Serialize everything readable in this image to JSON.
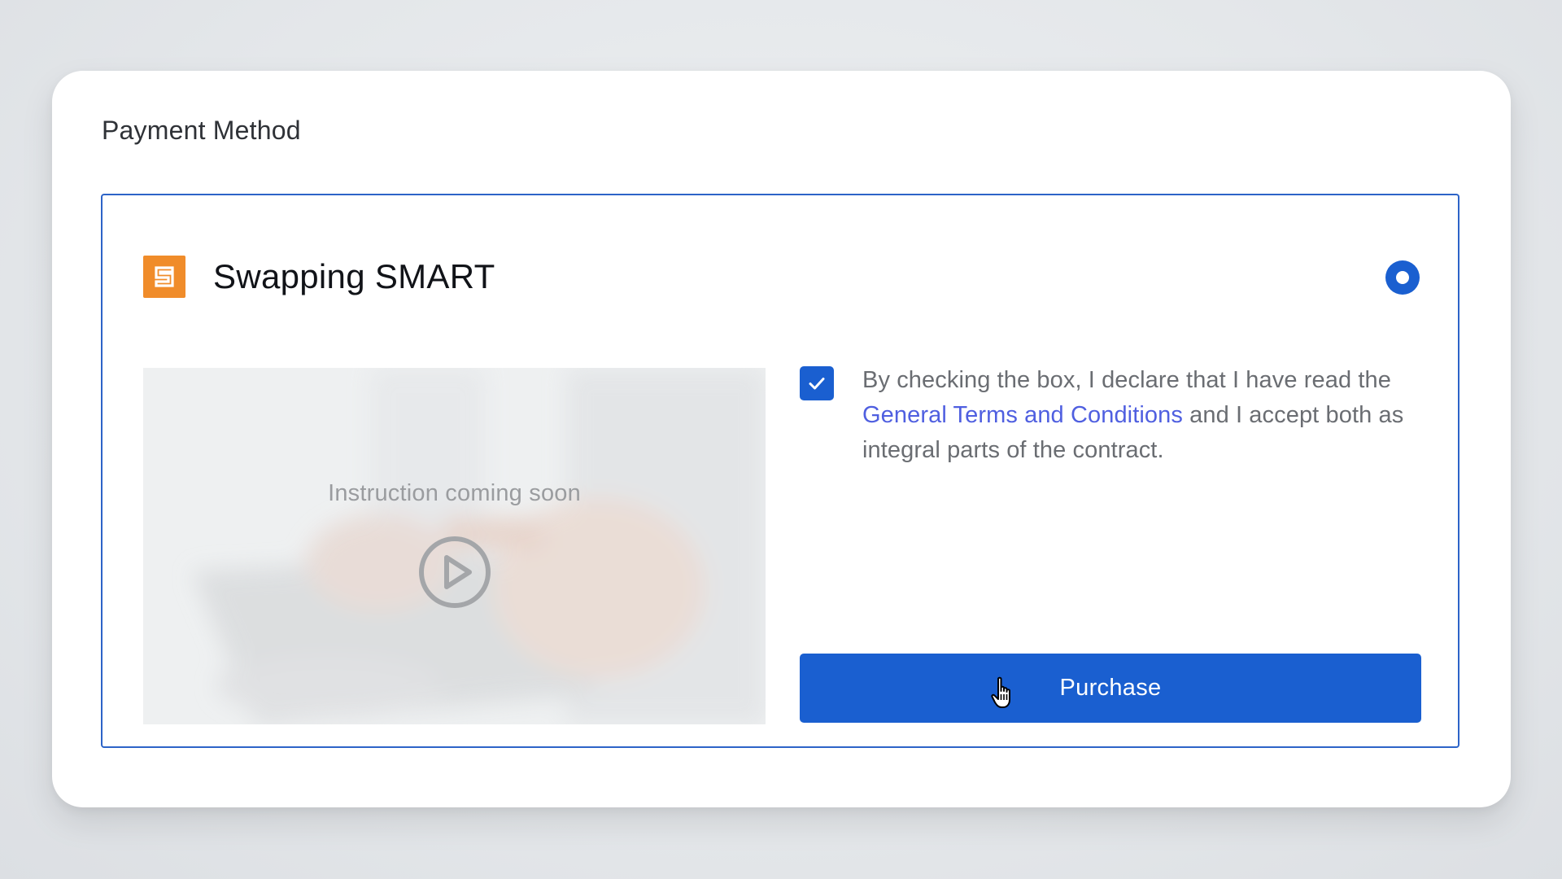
{
  "card": {
    "title": "Payment Method"
  },
  "method": {
    "name": "Swapping SMART",
    "logo_icon": "swapping-smart-logo",
    "logo_color": "#f08c2a",
    "selected": true
  },
  "video": {
    "caption": "Instruction coming soon",
    "icon": "play-icon"
  },
  "terms": {
    "checked": true,
    "text_before": "By checking the box, I declare that I have read the ",
    "link_text": "General Terms and Conditions",
    "text_after": " and I accept both as integral parts of the contract."
  },
  "actions": {
    "purchase_label": "Purchase"
  },
  "colors": {
    "accent": "#1a5fd0",
    "link": "#4f5fe0",
    "border": "#2d64c8"
  }
}
